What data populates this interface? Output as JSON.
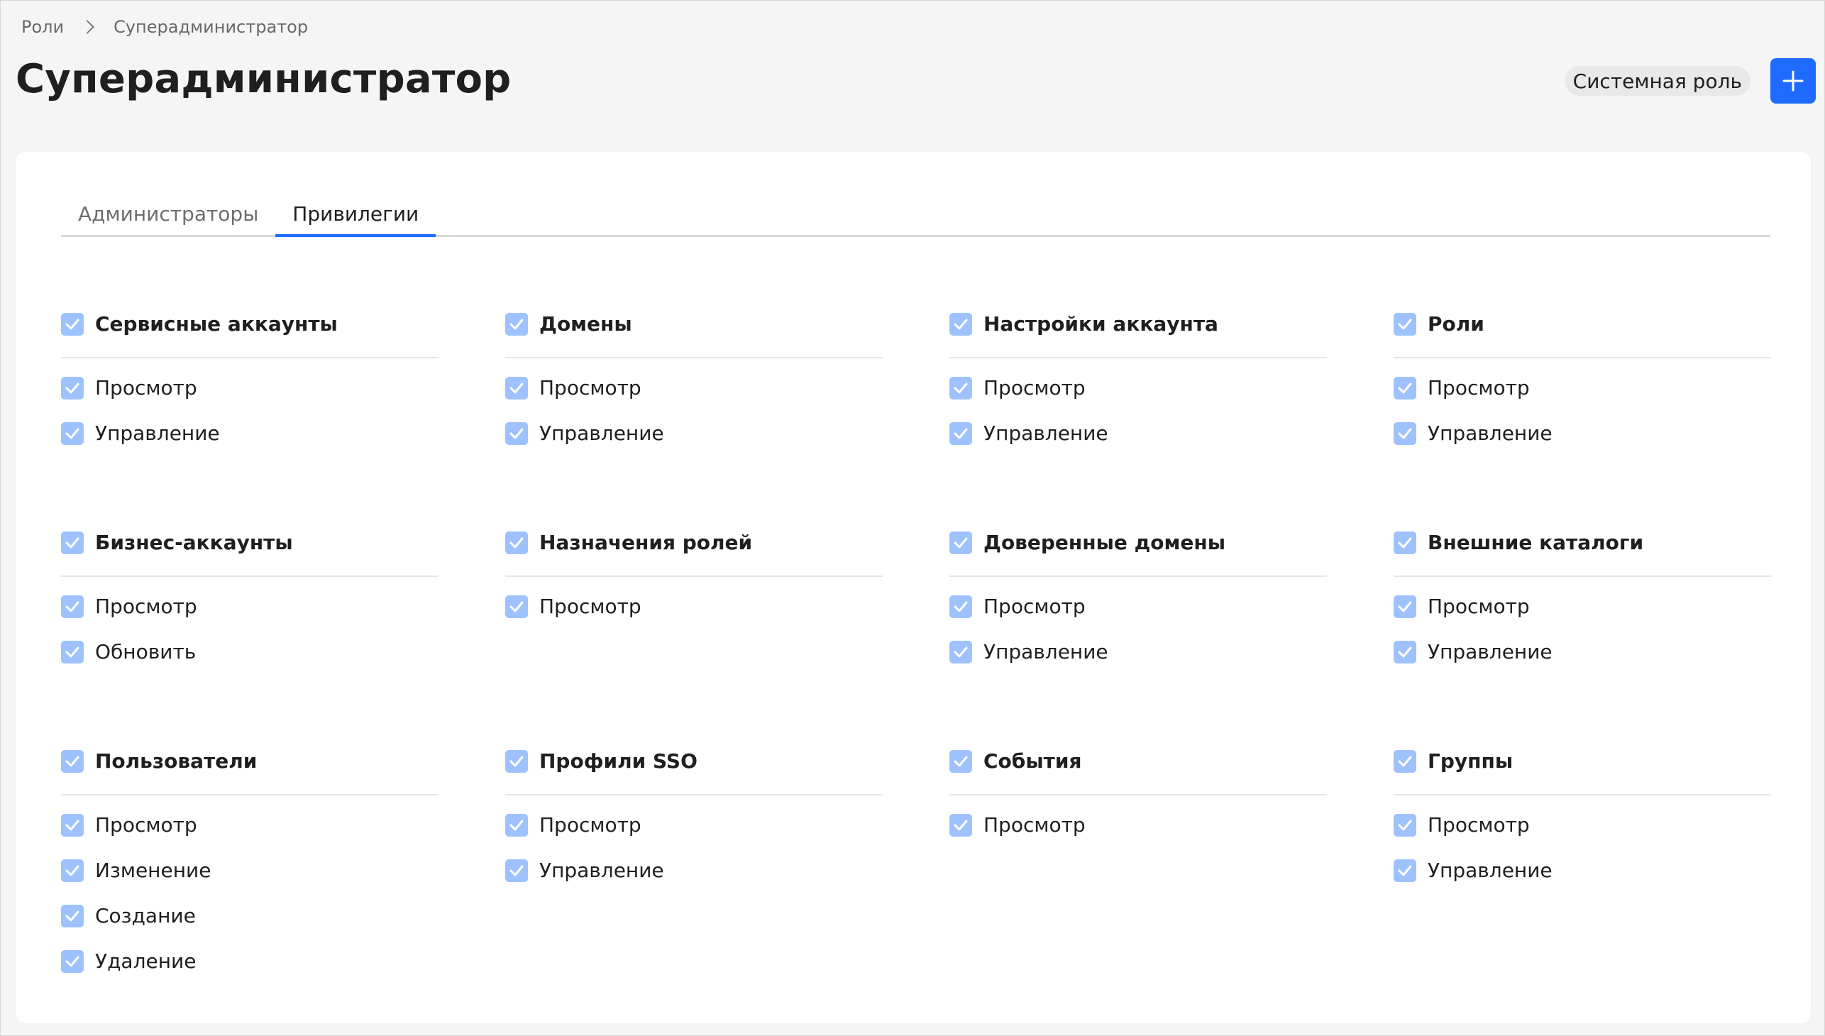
{
  "breadcrumb": {
    "root": "Роли",
    "current": "Суперадминистратор"
  },
  "page_title": "Суперадминистратор",
  "role_badge": "Системная роль",
  "add_button_icon": "plus-icon",
  "tabs": [
    {
      "label": "Администраторы",
      "active": false
    },
    {
      "label": "Привилегии",
      "active": true
    }
  ],
  "colors": {
    "accent": "#1f6bff",
    "checkbox_checked_disabled": "#9ec2ff",
    "background": "#f5f5f5",
    "card": "#ffffff"
  },
  "groups": [
    {
      "title": "Сервисные аккаунты",
      "checked": true,
      "permissions": [
        {
          "label": "Просмотр",
          "checked": true
        },
        {
          "label": "Управление",
          "checked": true
        }
      ]
    },
    {
      "title": "Домены",
      "checked": true,
      "permissions": [
        {
          "label": "Просмотр",
          "checked": true
        },
        {
          "label": "Управление",
          "checked": true
        }
      ]
    },
    {
      "title": "Настройки аккаунта",
      "checked": true,
      "permissions": [
        {
          "label": "Просмотр",
          "checked": true
        },
        {
          "label": "Управление",
          "checked": true
        }
      ]
    },
    {
      "title": "Роли",
      "checked": true,
      "permissions": [
        {
          "label": "Просмотр",
          "checked": true
        },
        {
          "label": "Управление",
          "checked": true
        }
      ]
    },
    {
      "title": "Бизнес-аккаунты",
      "checked": true,
      "permissions": [
        {
          "label": "Просмотр",
          "checked": true
        },
        {
          "label": "Обновить",
          "checked": true
        }
      ]
    },
    {
      "title": "Назначения ролей",
      "checked": true,
      "permissions": [
        {
          "label": "Просмотр",
          "checked": true
        }
      ]
    },
    {
      "title": "Доверенные домены",
      "checked": true,
      "permissions": [
        {
          "label": "Просмотр",
          "checked": true
        },
        {
          "label": "Управление",
          "checked": true
        }
      ]
    },
    {
      "title": "Внешние каталоги",
      "checked": true,
      "permissions": [
        {
          "label": "Просмотр",
          "checked": true
        },
        {
          "label": "Управление",
          "checked": true
        }
      ]
    },
    {
      "title": "Пользователи",
      "checked": true,
      "permissions": [
        {
          "label": "Просмотр",
          "checked": true
        },
        {
          "label": "Изменение",
          "checked": true
        },
        {
          "label": "Создание",
          "checked": true
        },
        {
          "label": "Удаление",
          "checked": true
        }
      ]
    },
    {
      "title": "Профили SSO",
      "checked": true,
      "permissions": [
        {
          "label": "Просмотр",
          "checked": true
        },
        {
          "label": "Управление",
          "checked": true
        }
      ]
    },
    {
      "title": "События",
      "checked": true,
      "permissions": [
        {
          "label": "Просмотр",
          "checked": true
        }
      ]
    },
    {
      "title": "Группы",
      "checked": true,
      "permissions": [
        {
          "label": "Просмотр",
          "checked": true
        },
        {
          "label": "Управление",
          "checked": true
        }
      ]
    }
  ]
}
